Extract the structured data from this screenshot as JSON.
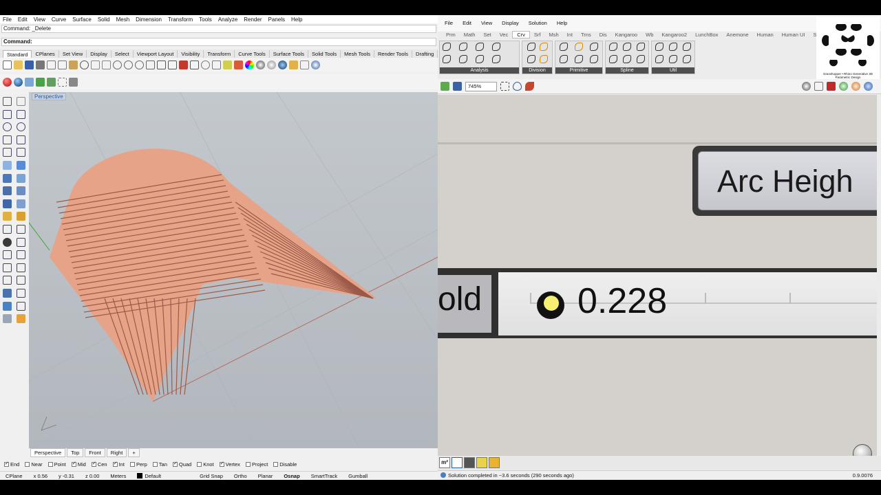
{
  "rhino": {
    "menu": [
      "File",
      "Edit",
      "View",
      "Curve",
      "Surface",
      "Solid",
      "Mesh",
      "Dimension",
      "Transform",
      "Tools",
      "Analyze",
      "Render",
      "Panels",
      "Help"
    ],
    "command_history": "Command: _Delete",
    "command_prompt": "Command:",
    "toolbar_tabs": [
      "Standard",
      "CPlanes",
      "Set View",
      "Display",
      "Select",
      "Viewport Layout",
      "Visibility",
      "Transform",
      "Curve Tools",
      "Surface Tools",
      "Solid Tools",
      "Mesh Tools",
      "Render Tools",
      "Drafting"
    ],
    "viewport_title": "Perspective",
    "viewport_tabs": [
      "Perspective",
      "Top",
      "Front",
      "Right",
      "+"
    ],
    "osnaps": [
      {
        "label": "End",
        "checked": true
      },
      {
        "label": "Near",
        "checked": false
      },
      {
        "label": "Point",
        "checked": false
      },
      {
        "label": "Mid",
        "checked": true
      },
      {
        "label": "Cen",
        "checked": true
      },
      {
        "label": "Int",
        "checked": true
      },
      {
        "label": "Perp",
        "checked": false
      },
      {
        "label": "Tan",
        "checked": false
      },
      {
        "label": "Quad",
        "checked": true
      },
      {
        "label": "Knot",
        "checked": false
      },
      {
        "label": "Vertex",
        "checked": true
      },
      {
        "label": "Project",
        "checked": false
      },
      {
        "label": "Disable",
        "checked": false
      }
    ],
    "status": {
      "cplane": "CPlane",
      "x": "x 0.56",
      "y": "y -0.31",
      "z": "z 0.00",
      "units": "Meters",
      "layer": "Default",
      "grid_snap": "Grid Snap",
      "ortho": "Ortho",
      "planar": "Planar",
      "osnap": "Osnap",
      "smarttrack": "SmartTrack",
      "gumball": "Gumball"
    },
    "colors": {
      "model": "#e8a489",
      "viewport_bg": "#bcc1c6"
    }
  },
  "grasshopper": {
    "menu": [
      "File",
      "Edit",
      "View",
      "Display",
      "Solution",
      "Help"
    ],
    "tabs": [
      "Prm",
      "Math",
      "Set",
      "Vec",
      "Crv",
      "Srf",
      "Msh",
      "Int",
      "Trns",
      "Dis",
      "Kangaroo",
      "Wb",
      "Kangaroo2",
      "LunchBox",
      "Anemone",
      "Human",
      "Human UI",
      "Sandbox"
    ],
    "active_tab": "Crv",
    "ribbon_groups": [
      "Analysis",
      "Division",
      "Primitive",
      "Spline",
      "Util"
    ],
    "logo_caption": "Grasshopper • Rhino Generative 3D Parametric Design",
    "zoom": "745%",
    "panel_text": "Arc Heigh",
    "slider_left_text": "old",
    "slider_value": "0.228",
    "status_message": "Solution completed in ~3.6 seconds (290 seconds ago)",
    "version": "0.9.0076"
  }
}
